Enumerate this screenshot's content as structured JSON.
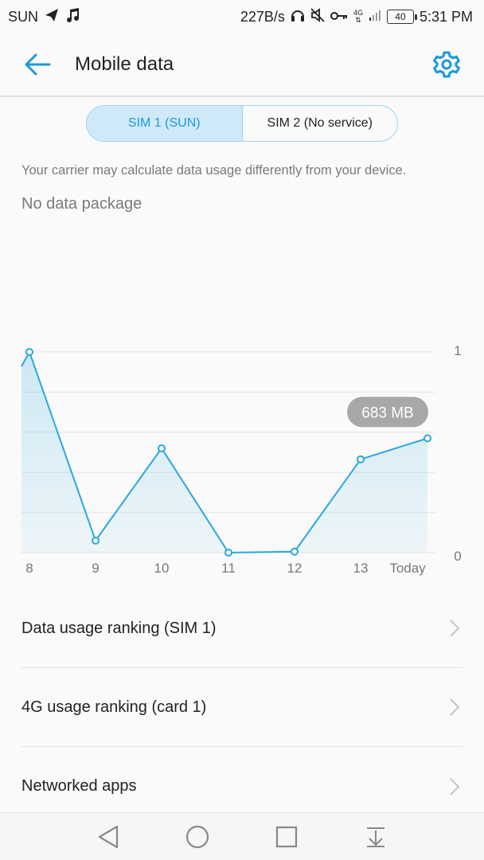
{
  "status_bar": {
    "carrier": "SUN",
    "speed": "227B/s",
    "network": "4G",
    "battery": "40",
    "time": "5:31 PM"
  },
  "app_bar": {
    "title": "Mobile data"
  },
  "sim_tabs": [
    {
      "label": "SIM 1 (SUN)",
      "selected": true
    },
    {
      "label": "SIM 2 (No service)",
      "selected": false
    }
  ],
  "carrier_note": "Your carrier may calculate data usage differently from your device.",
  "package_status": "No data package",
  "chart_data": {
    "type": "area",
    "categories": [
      "8",
      "9",
      "10",
      "11",
      "12",
      "13",
      "Today"
    ],
    "values": [
      1.0,
      0.06,
      0.52,
      0.0,
      0.005,
      0.465,
      0.57
    ],
    "y_tick_labels": [
      "1",
      "0"
    ],
    "ylim": [
      0,
      1
    ],
    "grid": true,
    "callout": "683 MB",
    "accent_color": "#29a8dd"
  },
  "list_items": [
    {
      "label": "Data usage ranking (SIM 1)"
    },
    {
      "label": "4G usage ranking (card 1)"
    },
    {
      "label": "Networked apps"
    }
  ],
  "colors": {
    "accent": "#1a9ad9",
    "sim_selected_bg": "#cfe9f8"
  }
}
